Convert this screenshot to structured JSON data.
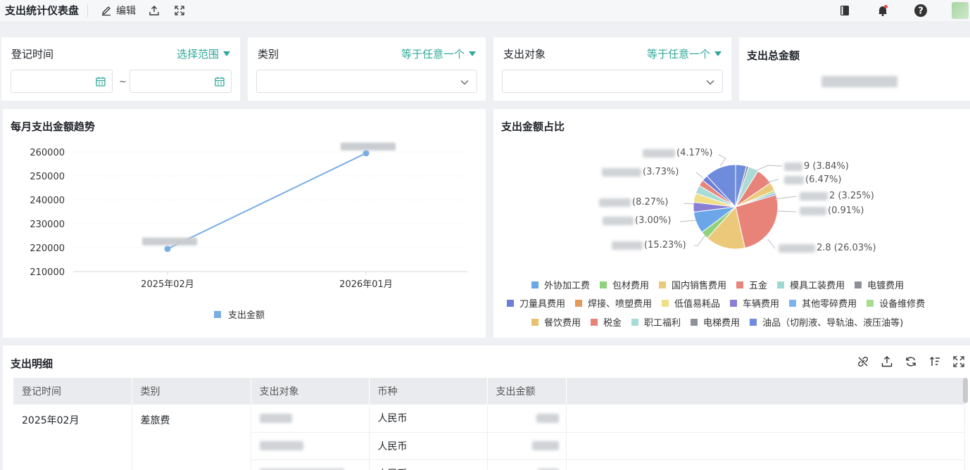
{
  "topbar": {
    "title": "支出统计仪表盘",
    "edit_label": "编辑"
  },
  "filters": {
    "date": {
      "label": "登记时间",
      "link": "选择范围",
      "separator": "~"
    },
    "category": {
      "label": "类别",
      "link": "等于任意一个"
    },
    "target": {
      "label": "支出对象",
      "link": "等于任意一个"
    }
  },
  "total": {
    "title": "支出总金额"
  },
  "trend": {
    "title": "每月支出金额趋势",
    "legend": "支出金额"
  },
  "pie": {
    "title": "支出金额占比",
    "legend": [
      {
        "name": "外协加工费",
        "color": "#6aa6e8"
      },
      {
        "name": "包材费用",
        "color": "#8fd17c"
      },
      {
        "name": "国内销售费用",
        "color": "#ecc97a"
      },
      {
        "name": "五金",
        "color": "#e8857a"
      },
      {
        "name": "模具工装费用",
        "color": "#9ed8d0"
      },
      {
        "name": "电镀费用",
        "color": "#8d9099"
      },
      {
        "name": "刀量具费用",
        "color": "#6b7fd6"
      },
      {
        "name": "焊接、喷塑费用",
        "color": "#e39a5b"
      },
      {
        "name": "低值易耗品",
        "color": "#f0df86"
      },
      {
        "name": "车辆费用",
        "color": "#8a7fd4"
      },
      {
        "name": "其他零碎费用",
        "color": "#79b4f0"
      },
      {
        "name": "设备维修费",
        "color": "#a6dc8e"
      },
      {
        "name": "餐饮费用",
        "color": "#e9c06c"
      },
      {
        "name": "税金",
        "color": "#e8837a"
      },
      {
        "name": "职工福利",
        "color": "#a9dcd6"
      },
      {
        "name": "电梯费用",
        "color": "#8e929b"
      },
      {
        "name": "油品（切削液、导轨油、液压油等)",
        "color": "#6f8cdc"
      }
    ],
    "labels": {
      "l1": "(4.17%)",
      "l2": "(3.73%)",
      "l3": "(8.27%)",
      "l4": "(3.00%)",
      "l5": "(15.23%)",
      "r1": "9 (3.84%)",
      "r2": "(6.47%)",
      "r3": "2 (3.25%)",
      "r4": "(0.91%)",
      "r5": "2.8 (26.03%)"
    }
  },
  "detail": {
    "title": "支出明细",
    "columns": [
      "登记时间",
      "类别",
      "支出对象",
      "币种",
      "支出金额"
    ],
    "rows": [
      {
        "date": "2025年02月",
        "category": "差旅费",
        "currency": "人民币"
      },
      {
        "date": "",
        "category": "",
        "currency": "人民币"
      },
      {
        "date": "",
        "category": "",
        "currency": "人民币"
      }
    ]
  },
  "chart_data": {
    "type": "line",
    "x": [
      "2025年02月",
      "2026年01月"
    ],
    "series": [
      {
        "name": "支出金额",
        "values": [
          219500,
          259500
        ],
        "color": "#79aee4"
      }
    ],
    "ylim": [
      210000,
      260000
    ],
    "yticks": [
      "260000",
      "250000",
      "240000",
      "230000",
      "220000",
      "210000"
    ],
    "grid": true,
    "legend": "bottom"
  }
}
